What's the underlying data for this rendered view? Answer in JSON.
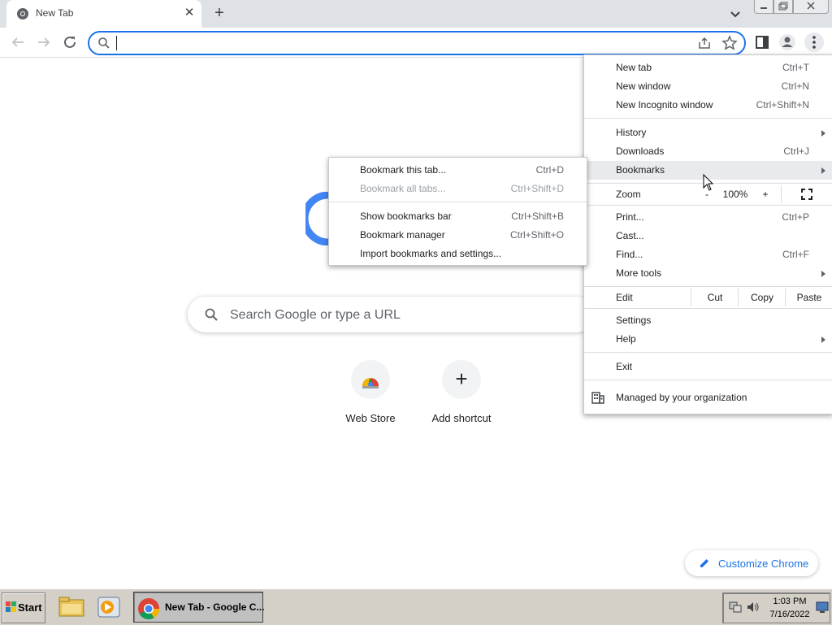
{
  "tab": {
    "title": "New Tab"
  },
  "omnibox": {
    "value": ""
  },
  "ntp": {
    "search_placeholder": "Search Google or type a URL",
    "shortcuts": [
      {
        "label": "Web Store",
        "icon": "web-store-icon"
      },
      {
        "label": "Add shortcut",
        "icon": "plus-icon"
      }
    ],
    "customize_label": "Customize Chrome"
  },
  "main_menu": {
    "items": [
      {
        "label": "New tab",
        "accel": "Ctrl+T"
      },
      {
        "label": "New window",
        "accel": "Ctrl+N"
      },
      {
        "label": "New Incognito window",
        "accel": "Ctrl+Shift+N"
      },
      {
        "label": "History",
        "accel": ""
      },
      {
        "label": "Downloads",
        "accel": "Ctrl+J"
      },
      {
        "label": "Bookmarks",
        "accel": ""
      },
      {
        "label": "Zoom",
        "accel": ""
      },
      {
        "label": "Print...",
        "accel": "Ctrl+P"
      },
      {
        "label": "Cast...",
        "accel": ""
      },
      {
        "label": "Find...",
        "accel": "Ctrl+F"
      },
      {
        "label": "More tools",
        "accel": ""
      },
      {
        "label": "Edit",
        "accel": ""
      },
      {
        "label": "Settings",
        "accel": ""
      },
      {
        "label": "Help",
        "accel": ""
      },
      {
        "label": "Exit",
        "accel": ""
      }
    ],
    "zoom": {
      "minus": "-",
      "level": "100%",
      "plus": "+"
    },
    "edit": {
      "cut": "Cut",
      "copy": "Copy",
      "paste": "Paste"
    },
    "managed": "Managed by your organization"
  },
  "bookmarks_menu": {
    "items": [
      {
        "label": "Bookmark this tab...",
        "accel": "Ctrl+D",
        "enabled": true
      },
      {
        "label": "Bookmark all tabs...",
        "accel": "Ctrl+Shift+D",
        "enabled": false
      },
      {
        "label": "Show bookmarks bar",
        "accel": "Ctrl+Shift+B",
        "enabled": true
      },
      {
        "label": "Bookmark manager",
        "accel": "Ctrl+Shift+O",
        "enabled": true
      },
      {
        "label": "Import bookmarks and settings...",
        "accel": "",
        "enabled": true
      }
    ]
  },
  "taskbar": {
    "start_label": "Start",
    "active_task_label": "New Tab - Google C...",
    "time": "1:03 PM",
    "date": "7/16/2022"
  },
  "colors": {
    "accent": "#1a73e8",
    "menu_highlight": "#e8eaed",
    "taskbar": "#d4d0c8"
  }
}
